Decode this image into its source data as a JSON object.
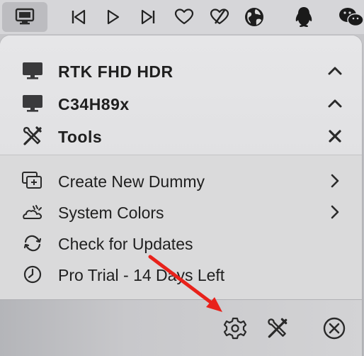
{
  "menubar": {
    "icons": [
      "display-icon",
      "skip-back-icon",
      "play-icon",
      "skip-forward-icon",
      "heart-icon",
      "heart-slash-icon",
      "globe-icon",
      "penguin-icon",
      "wechat-icon"
    ]
  },
  "displays": [
    {
      "label": "RTK FHD HDR",
      "icon": "monitor-icon",
      "trail": "chevron-up-icon"
    },
    {
      "label": "C34H89x",
      "icon": "monitor-icon",
      "trail": "chevron-up-icon"
    },
    {
      "label": "Tools",
      "icon": "tools-icon",
      "trail": "close-icon"
    }
  ],
  "menu": [
    {
      "label": "Create New Dummy",
      "icon": "add-display-icon",
      "trail": "chevron-right-icon"
    },
    {
      "label": "System Colors",
      "icon": "cloud-sun-icon",
      "trail": "chevron-right-icon"
    },
    {
      "label": "Check for Updates",
      "icon": "refresh-icon",
      "trail": ""
    },
    {
      "label": "Pro Trial - 14 Days Left",
      "icon": "clock-icon",
      "trail": ""
    }
  ],
  "bottom_bar": {
    "buttons": [
      "settings-icon",
      "tools-icon",
      "quit-icon"
    ]
  },
  "annotation_color": "#e8221b"
}
